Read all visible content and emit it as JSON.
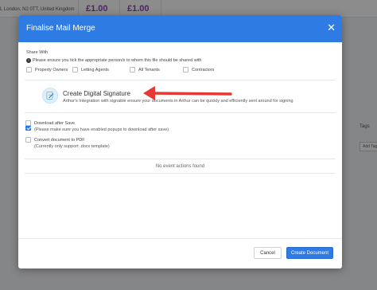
{
  "background": {
    "address": "L London, N2 0TT, United Kingdom",
    "price_1": "£1.00",
    "price_2": "£1.00",
    "tags_header": "Tags",
    "add_tag_placeholder": "Add Tags"
  },
  "modal": {
    "title": "Finalise Mail Merge",
    "close_glyph": "✕",
    "share": {
      "label": "Share With",
      "note": "Please ensure you tick the appropriate person/s to whom this file should be shared with",
      "options": [
        "Property Owners",
        "Letting Agents",
        "All Tenants",
        "Contractors"
      ]
    },
    "signature": {
      "checked": true,
      "title": "Create Digital Signature",
      "description": "Arthur's Integration with signable ensure your documents in Arthur can be quickly and efficiently sent around for signing"
    },
    "download": {
      "label": "Download after Save",
      "note": "(Please make sure you have enabled popups to download after save)"
    },
    "convert": {
      "label": "Convert document to PDF",
      "note": "(Currently only support .docx template)"
    },
    "events_empty": "No event actions found",
    "buttons": {
      "cancel": "Cancel",
      "create": "Create Document"
    }
  },
  "colors": {
    "primary": "#2f7be4",
    "annotation_arrow": "#e53935",
    "price": "#8e44ad"
  },
  "icons": {
    "close": "close-icon",
    "info": "info-icon",
    "signature": "signature-icon",
    "arrow": "red-arrow-annotation-icon"
  }
}
